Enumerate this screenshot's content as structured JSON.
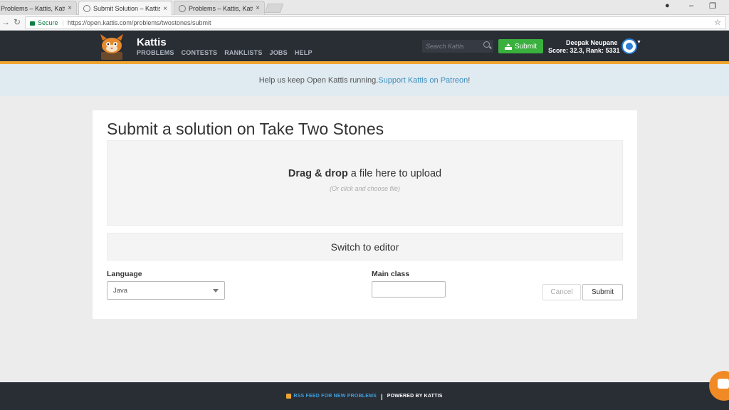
{
  "browser": {
    "tabs": [
      {
        "label": "Problems – Kattis, Kattis"
      },
      {
        "label": "Submit Solution – Kattis"
      },
      {
        "label": "Problems – Kattis, Kattis"
      }
    ],
    "close_glyph": "×",
    "secure_label": "Secure",
    "url": "https://open.kattis.com/problems/twostones/submit"
  },
  "header": {
    "brand": "Kattis",
    "nav": [
      "PROBLEMS",
      "CONTESTS",
      "RANKLISTS",
      "JOBS",
      "HELP"
    ],
    "search_placeholder": "Search Kattis",
    "submit_label": "Submit",
    "user_name": "Deepak Neupane",
    "user_score": "Score: 32.3, Rank: 5331"
  },
  "banner": {
    "text": "Help us keep Open Kattis running. ",
    "link": "Support Kattis on Patreon",
    "suffix": "!"
  },
  "form": {
    "title": "Submit a solution on Take Two Stones",
    "drop_bold": "Drag & drop",
    "drop_rest": " a file here to upload",
    "drop_sub": "(Or click and choose file)",
    "switch_editor": "Switch to editor",
    "language_label": "Language",
    "language_value": "Java",
    "main_class_label": "Main class",
    "main_class_value": "",
    "cancel": "Cancel",
    "submit": "Submit"
  },
  "footer": {
    "rss": "RSS FEED FOR NEW PROBLEMS",
    "separator": "|",
    "powered": "POWERED BY KATTIS"
  },
  "colors": {
    "header_bg": "#292d34",
    "accent_orange": "#f0a531",
    "submit_green": "#3ab03e",
    "link_blue": "#3c8dbc",
    "banner_bg": "#dfeaf1"
  },
  "icons": [
    "favicon-icon",
    "close-icon",
    "back-icon",
    "reload-icon",
    "lock-icon",
    "star-icon",
    "account-icon",
    "minimize-icon",
    "restore-icon",
    "kattis-logo",
    "search-icon",
    "upload-icon",
    "avatar-icon",
    "chevron-down-icon",
    "rss-icon",
    "chat-icon"
  ]
}
